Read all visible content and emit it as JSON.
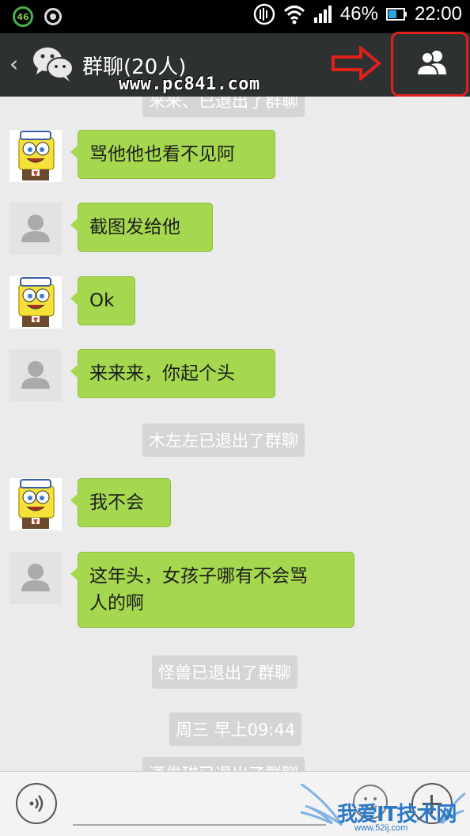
{
  "status_bar": {
    "badge_number": "46",
    "battery_percent": "46%",
    "time": "22:00"
  },
  "header": {
    "back_icon": "chevron-left-icon",
    "logo_icon": "wechat-logo-icon",
    "title": "群聊(20人)",
    "group_icon": "group-members-icon",
    "watermark": "www.pc841.com"
  },
  "chat": {
    "messages": [
      {
        "type": "system",
        "text": "来来、已退出了群聊"
      },
      {
        "type": "text",
        "avatar": "spongebob",
        "text": "骂他他也看不见阿"
      },
      {
        "type": "text",
        "avatar": "default",
        "text": "截图发给他"
      },
      {
        "type": "text",
        "avatar": "spongebob",
        "text": "Ok"
      },
      {
        "type": "text",
        "avatar": "default",
        "text": "来来来，你起个头"
      },
      {
        "type": "system",
        "text": "木左左已退出了群聊"
      },
      {
        "type": "text",
        "avatar": "spongebob",
        "text": "我不会"
      },
      {
        "type": "text",
        "avatar": "default",
        "text_line1": "这年头，女孩子哪有不会骂",
        "text_line2": "人的啊"
      },
      {
        "type": "system",
        "text": "怪兽已退出了群聊"
      },
      {
        "type": "timestamp",
        "text": "周三  早上09:44"
      },
      {
        "type": "system",
        "text": "潇俊琪已退出了群聊"
      }
    ]
  },
  "input_bar": {
    "voice_icon": "voice-icon",
    "emoji_icon": "emoji-icon",
    "plus_icon": "plus-icon",
    "watermark": "我爱IT技术网",
    "watermark_url": "www.52ij.com"
  },
  "colors": {
    "bubble": "#a5d84f",
    "titlebar": "#2e3132",
    "annotation": "#e0201a"
  }
}
